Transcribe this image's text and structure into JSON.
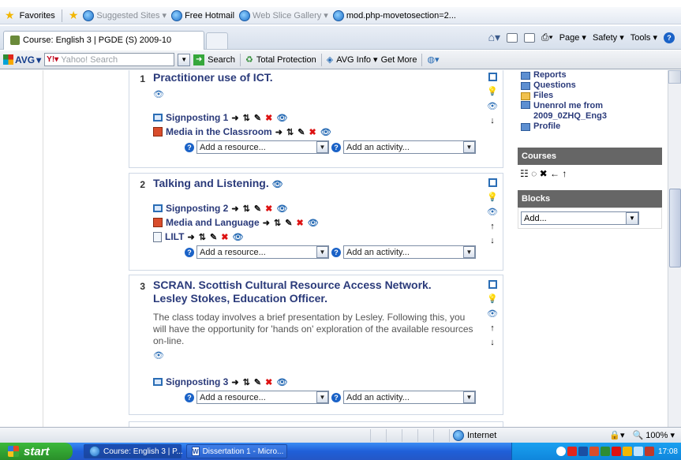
{
  "favorites_bar": {
    "favorites_label": "Favorites",
    "links": [
      {
        "label": "Suggested Sites ▾",
        "dim": true
      },
      {
        "label": "Free Hotmail",
        "dim": false
      },
      {
        "label": "Web Slice Gallery ▾",
        "dim": true
      },
      {
        "label": "mod.php-movetosection=2...",
        "dim": false
      }
    ]
  },
  "tab": {
    "title": "Course: English 3 | PGDE (S) 2009-10"
  },
  "ie_tools": {
    "page": "Page ▾",
    "safety": "Safety ▾",
    "tools": "Tools ▾"
  },
  "avg_bar": {
    "logo": "AVG",
    "search_placeholder": "Yahoo! Search",
    "search_button": "Search",
    "total_protection": "Total Protection",
    "avg_info": "AVG Info ▾",
    "get_more": "Get More"
  },
  "course": {
    "sections": [
      {
        "number": "1",
        "title": "Practitioner use of ICT.",
        "summary": "",
        "resources": [
          {
            "type": "signposting",
            "label": "Signposting 1"
          },
          {
            "type": "media",
            "label": "Media in the Classroom"
          }
        ],
        "add_resource": "Add a resource...",
        "add_activity": "Add an activity..."
      },
      {
        "number": "2",
        "title": "Talking and Listening.",
        "summary": "",
        "resources": [
          {
            "type": "signposting",
            "label": "Signposting 2"
          },
          {
            "type": "media",
            "label": "Media and Language"
          },
          {
            "type": "lilt",
            "label": "LILT"
          }
        ],
        "add_resource": "Add a resource...",
        "add_activity": "Add an activity..."
      },
      {
        "number": "3",
        "title_line1": "SCRAN. Scottish Cultural Resource Access Network.",
        "title_line2": "Lesley Stokes, Education Officer.",
        "summary": "The class today involves a brief presentation by Lesley. Following this, you will have the opportunity for 'hands on' exploration of the available resources on-line.",
        "resources": [
          {
            "type": "signposting",
            "label": "Signposting 3"
          }
        ],
        "add_resource": "Add a resource...",
        "add_activity": "Add an activity..."
      }
    ]
  },
  "admin_block": {
    "links": [
      {
        "label": "Reports",
        "icon": "reports-icon"
      },
      {
        "label": "Questions",
        "icon": "questions-icon"
      },
      {
        "label": "Files",
        "icon": "folder-icon"
      },
      {
        "label": "Unenrol me from 2009_0ZHQ_Eng3",
        "icon": "unenrol-icon"
      },
      {
        "label": "Profile",
        "icon": "profile-icon"
      }
    ]
  },
  "courses_block": {
    "title": "Courses"
  },
  "blocks_block": {
    "title": "Blocks",
    "add_label": "Add..."
  },
  "status_bar": {
    "zone": "Internet",
    "zoom": "100%"
  },
  "taskbar": {
    "start": "start",
    "tasks": [
      {
        "label": "Course: English 3 | P...",
        "active": true
      },
      {
        "label": "Dissertation 1 - Micro...",
        "active": false
      }
    ],
    "clock": "17:08"
  }
}
